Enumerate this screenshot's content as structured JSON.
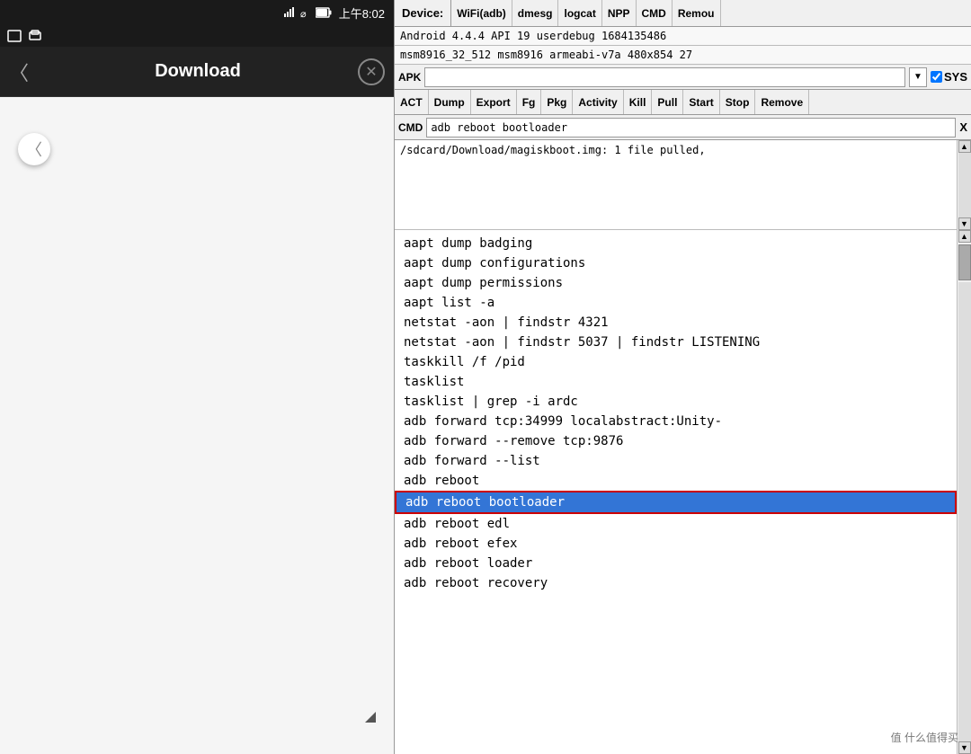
{
  "left_panel": {
    "status_bar": {
      "time": "上午8:02",
      "icons": [
        "signal",
        "wifi",
        "battery"
      ]
    },
    "download_title": "Download",
    "download_back": "〈",
    "download_close": "✕"
  },
  "right_panel": {
    "toolbar1": {
      "device_label": "Device:",
      "wifi_btn": "WiFi(adb)",
      "dmesg_btn": "dmesg",
      "logcat_btn": "logcat",
      "npp_btn": "NPP",
      "cmd_btn": "CMD",
      "remove_btn": "Remou"
    },
    "device_info1": "Android 4.4.4 API 19 userdebug 1684135486",
    "device_info2": "msm8916_32_512 msm8916 armeabi-v7a 480x854 27",
    "apk_label": "APK",
    "apk_value": "",
    "apk_dropdown": "▼",
    "sys_checkbox": "✓",
    "sys_label": "SYS",
    "actions": {
      "act_btn": "ACT",
      "dump_btn": "Dump",
      "export_btn": "Export",
      "fg_btn": "Fg",
      "pkg_btn": "Pkg",
      "activity_btn": "Activity",
      "kill_btn": "Kill",
      "pull_btn": "Pull",
      "start_btn": "Start",
      "stop_btn": "Stop",
      "remove_btn": "Remove"
    },
    "cmd_label": "CMD",
    "cmd_value": "adb reboot bootloader",
    "cmd_clear": "X",
    "output_text": "/sdcard/Download/magiskboot.img: 1 file pulled,",
    "commands": [
      "aapt dump badging",
      "aapt dump configurations",
      "aapt dump permissions",
      "aapt list -a",
      "netstat -aon | findstr 4321",
      "netstat -aon | findstr 5037 | findstr LISTENING",
      "taskkill /f /pid",
      "tasklist",
      "tasklist | grep -i ardc",
      "adb forward tcp:34999 localabstract:Unity-",
      "adb forward --remove tcp:9876",
      "adb forward --list",
      "adb reboot",
      "adb reboot bootloader",
      "adb reboot edl",
      "adb reboot efex",
      "adb reboot loader",
      "adb reboot recovery"
    ],
    "selected_command": "adb reboot bootloader",
    "watermark": "值 什么值得买"
  }
}
